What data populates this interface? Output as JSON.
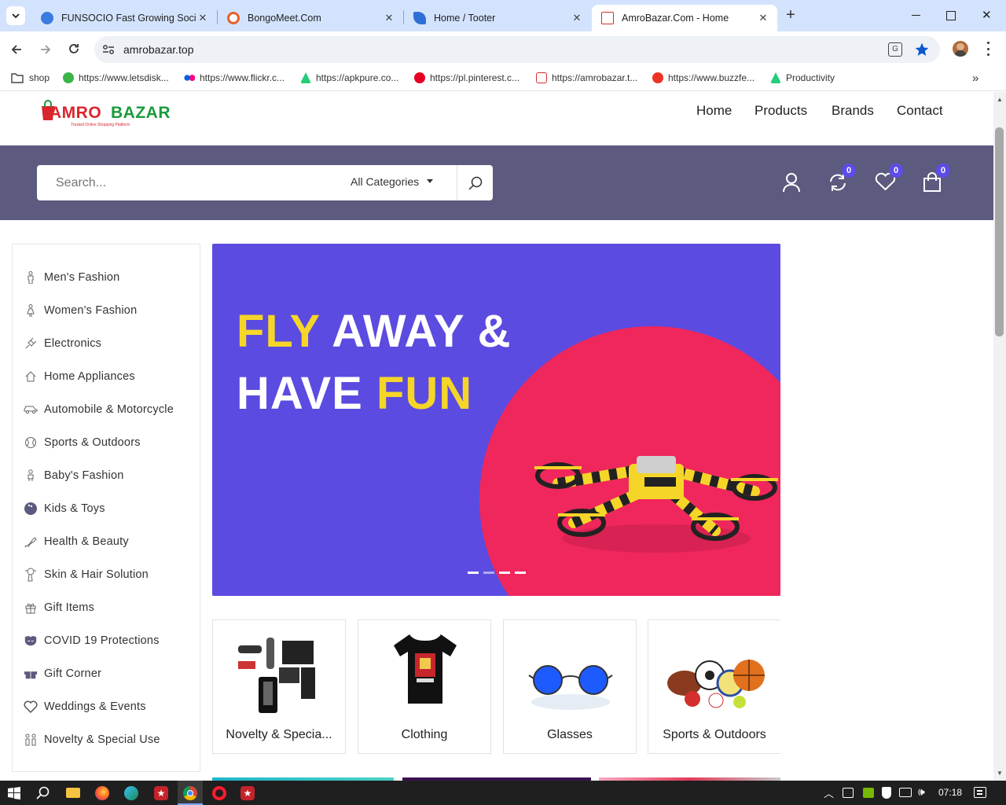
{
  "browser": {
    "tabs": [
      {
        "title": "FUNSOCIO Fast Growing Social",
        "color": "#3a7be0"
      },
      {
        "title": "BongoMeet.Com",
        "color": "#e8612c"
      },
      {
        "title": "Home / Tooter",
        "color": "#2f6fd6"
      },
      {
        "title": "AmroBazar.Com - Home",
        "color": "#d92d2d"
      }
    ],
    "url": "amrobazar.top",
    "bookmarks": [
      {
        "label": "shop"
      },
      {
        "label": "https://www.letsdisk..."
      },
      {
        "label": "https://www.flickr.c..."
      },
      {
        "label": "https://apkpure.co..."
      },
      {
        "label": "https://pl.pinterest.c..."
      },
      {
        "label": "https://amrobazar.t..."
      },
      {
        "label": "https://www.buzzfe..."
      },
      {
        "label": "Productivity"
      }
    ]
  },
  "site": {
    "logo": {
      "text_a": "AMRO",
      "text_b": "BAZAR",
      "tagline": "Trusted Online Shopping Platform"
    },
    "nav": [
      "Home",
      "Products",
      "Brands",
      "Contact"
    ],
    "search": {
      "placeholder": "Search...",
      "category": "All Categories"
    },
    "badges": {
      "compare": "0",
      "wishlist": "0",
      "cart": "0"
    },
    "categories": [
      "Men's Fashion",
      "Women's Fashion",
      "Electronics",
      "Home Appliances",
      "Automobile & Motorcycle",
      "Sports & Outdoors",
      "Baby's Fashion",
      "Kids & Toys",
      "Health & Beauty",
      "Skin & Hair Solution",
      "Gift Items",
      "COVID 19 Protections",
      "Gift Corner",
      "Weddings & Events",
      "Novelty & Special Use"
    ],
    "banner": {
      "word1": "FLY",
      "word2": "AWAY &",
      "word3": "HAVE",
      "word4": "FUN"
    },
    "tiles": [
      "Novelty & Specia...",
      "Clothing",
      "Glasses",
      "Sports & Outdoors"
    ]
  },
  "taskbar": {
    "time": "07:18"
  },
  "colors": {
    "brand": "#5b4be0",
    "accent_yellow": "#f6d529",
    "accent_pink": "#f0275c",
    "band": "#5c5a7e"
  }
}
